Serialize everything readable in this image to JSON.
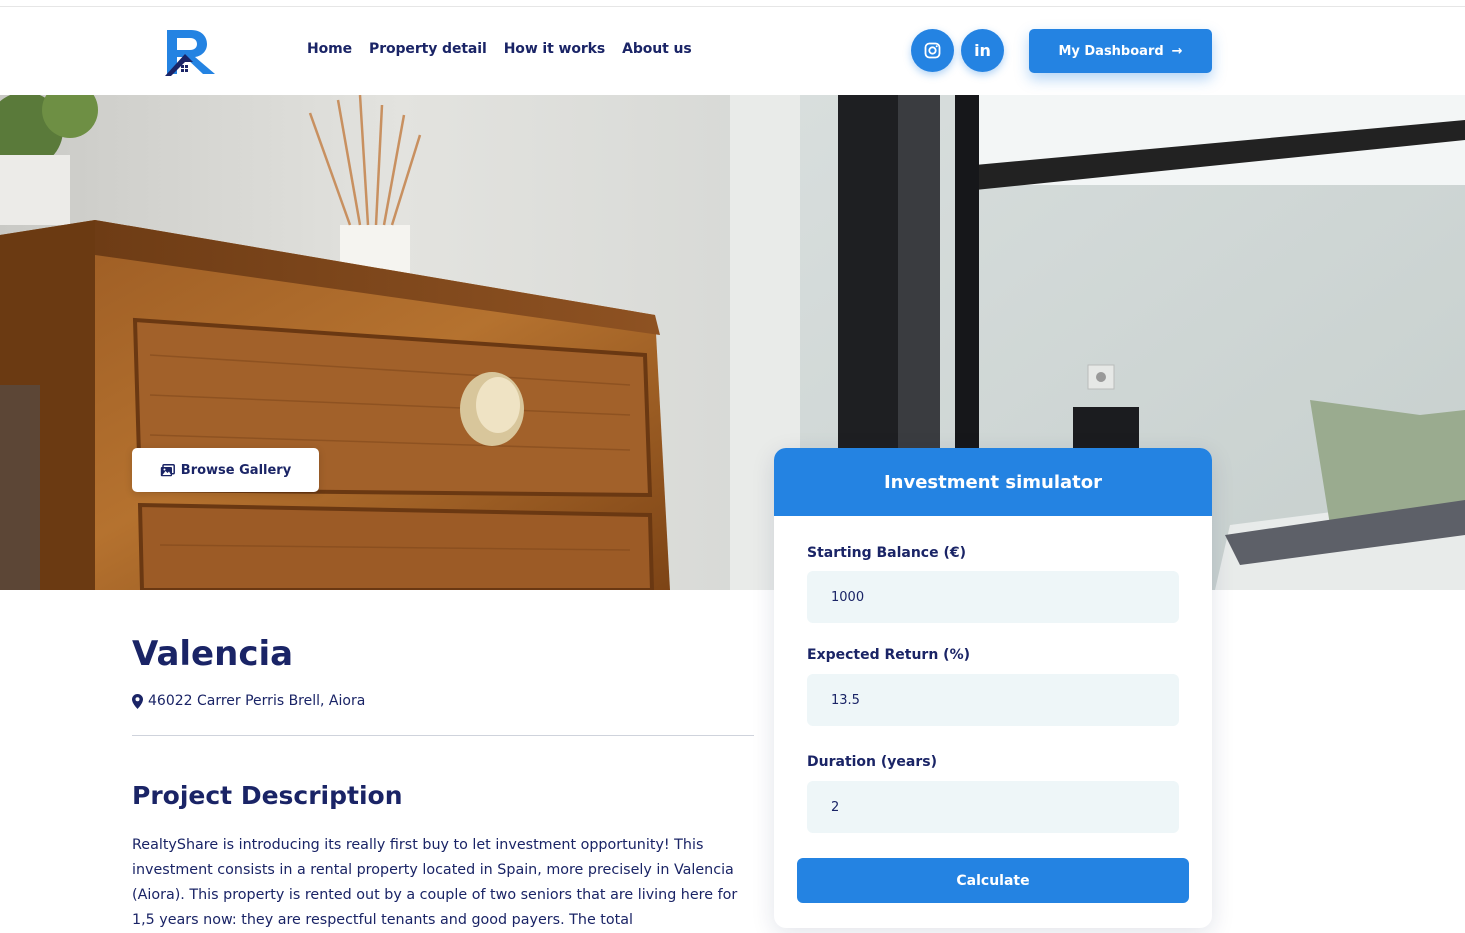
{
  "brand": {
    "logo_letter": "R",
    "primary_color": "#2483e2",
    "text_color": "#1a2466"
  },
  "nav": {
    "items": [
      {
        "label": "Home"
      },
      {
        "label": "Property detail"
      },
      {
        "label": "How it works"
      },
      {
        "label": "About us"
      }
    ]
  },
  "social": {
    "instagram_icon": "instagram-icon",
    "linkedin_label": "in"
  },
  "dashboard": {
    "label": "My Dashboard",
    "arrow": "→"
  },
  "hero": {
    "gallery_label": "Browse Gallery"
  },
  "property": {
    "title": "Valencia",
    "address": "46022 Carrer Perris Brell, Aiora",
    "description_title": "Project Description",
    "description": "RealtyShare is introducing its really first buy to let investment opportunity! This investment consists in a rental property located in Spain, more precisely in Valencia (Aiora). This property is rented out by a couple of two seniors that are living here for 1,5 years now: they are respectful tenants and good payers. The total"
  },
  "simulator": {
    "title": "Investment simulator",
    "fields": [
      {
        "label": "Starting Balance (€)",
        "value": "1000"
      },
      {
        "label": "Expected Return (%)",
        "value": "13.5"
      },
      {
        "label": "Duration (years)",
        "value": "2"
      }
    ],
    "button_label": "Calculate"
  }
}
